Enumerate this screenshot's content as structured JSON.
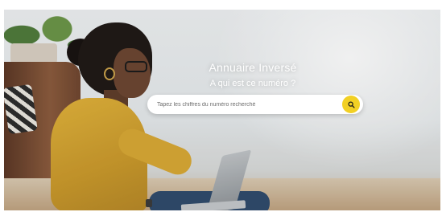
{
  "hero": {
    "title": "Annuaire Inversé",
    "subtitle": "A qui est ce numéro ?"
  },
  "search": {
    "placeholder": "Tapez les chiffres du numéro recherché",
    "button_icon": "search-icon",
    "button_color": "#f2d024"
  }
}
